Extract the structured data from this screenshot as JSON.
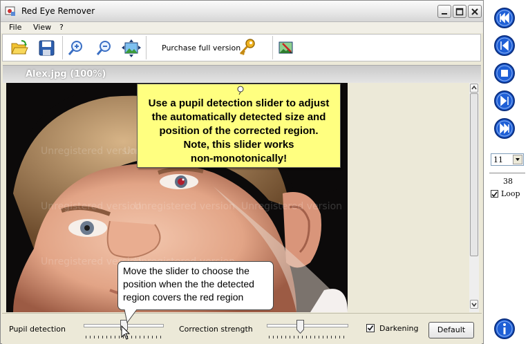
{
  "window": {
    "title": "Red Eye Remover"
  },
  "menu": [
    "File",
    "View",
    "?"
  ],
  "toolbar": {
    "buttons": [
      {
        "icon": "open-folder-icon"
      },
      {
        "icon": "save-disk-icon"
      },
      {
        "icon": "zoom-in-icon"
      },
      {
        "icon": "zoom-out-icon"
      },
      {
        "icon": "fit-to-window-icon"
      },
      {
        "icon": "key-icon"
      },
      {
        "icon": "edit-image-icon"
      }
    ],
    "purchase_label": "Purchase full version"
  },
  "document": {
    "tab_label": "Alex.jpg (100%)",
    "watermark": "Unregistered version"
  },
  "callouts": {
    "slider_tip": [
      "Use a pupil detection slider to adjust",
      "the automatically detected size and",
      "position of the corrected region.",
      "Note, this slider works",
      "non-monotonically!"
    ],
    "move_tip": [
      "Move the slider to choose the",
      "position when the the detected",
      "region covers the red region"
    ]
  },
  "controls": {
    "pupil_detection_label": "Pupil detection",
    "pupil_detection_value": 0.5,
    "correction_strength_label": "Correction strength",
    "correction_strength_value": 0.4,
    "darkening_label": "Darkening",
    "darkening_checked": true,
    "default_button": "Default"
  },
  "side_panel": {
    "buttons": [
      "first-slide-icon",
      "previous-slide-icon",
      "stop-icon",
      "next-slide-icon",
      "last-slide-icon"
    ],
    "slide_number": "11",
    "slide_count": "38",
    "loop_label": "Loop",
    "loop_checked": true,
    "info_icon": "info-icon"
  },
  "colors": {
    "callout_yellow": "#ffff80",
    "side_button_blue": "#1e5fd6",
    "pupil_red": "#b01d2d"
  }
}
